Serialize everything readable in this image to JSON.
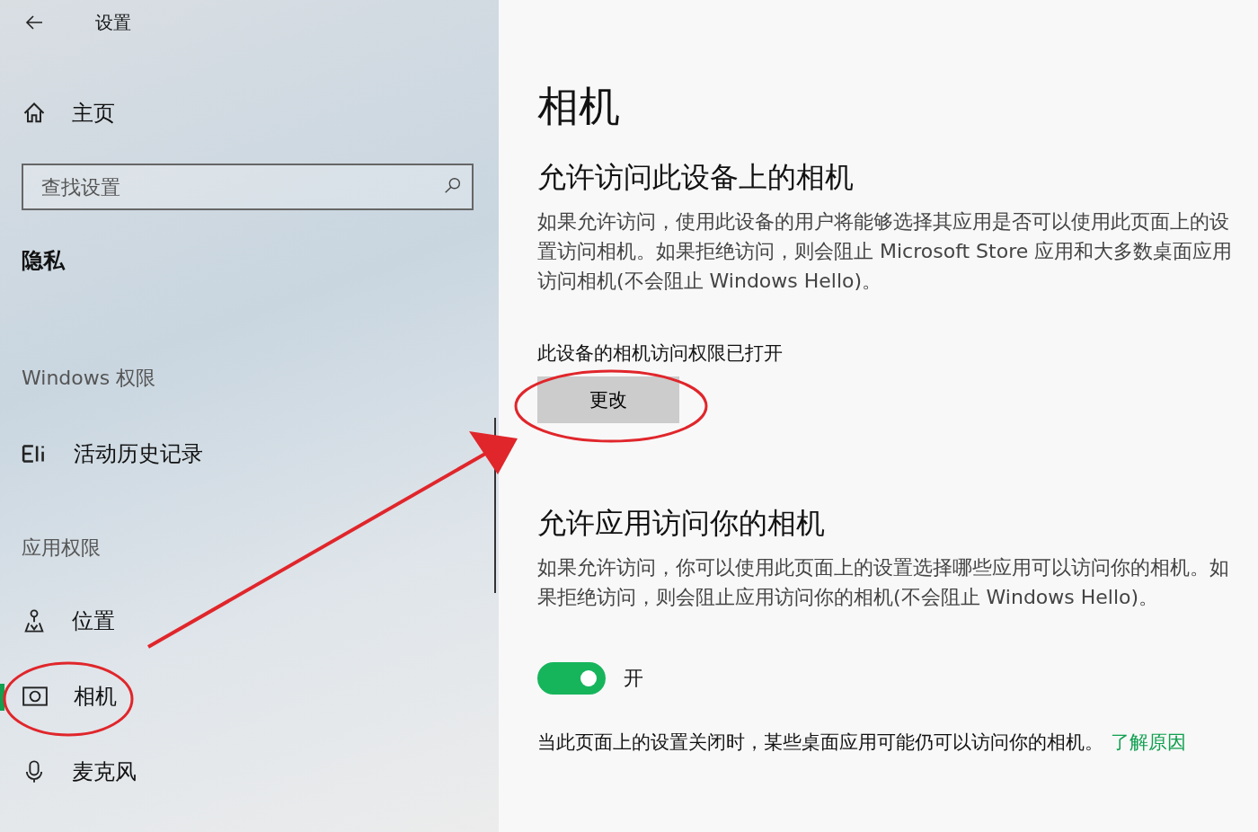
{
  "window": {
    "title": "设置"
  },
  "sidebar": {
    "home": "主页",
    "search": {
      "placeholder": "查找设置"
    },
    "section": "隐私",
    "groups": [
      {
        "heading": "Windows 权限",
        "items": [
          {
            "label": "活动历史记录",
            "kind": "history",
            "selected": false
          }
        ]
      },
      {
        "heading": "应用权限",
        "items": [
          {
            "label": "位置",
            "kind": "location",
            "selected": false
          },
          {
            "label": "相机",
            "kind": "camera",
            "selected": true
          },
          {
            "label": "麦克风",
            "kind": "mic",
            "selected": false
          }
        ]
      }
    ]
  },
  "content": {
    "title": "相机",
    "device_access": {
      "heading": "允许访问此设备上的相机",
      "description": "如果允许访问，使用此设备的用户将能够选择其应用是否可以使用此页面上的设置访问相机。如果拒绝访问，则会阻止 Microsoft Store 应用和大多数桌面应用访问相机(不会阻止 Windows Hello)。",
      "status": "此设备的相机访问权限已打开",
      "button": "更改"
    },
    "app_access": {
      "heading": "允许应用访问你的相机",
      "description": "如果允许访问，你可以使用此页面上的设置选择哪些应用可以访问你的相机。如果拒绝访问，则会阻止应用访问你的相机(不会阻止 Windows Hello)。",
      "toggle": {
        "on": true,
        "label": "开"
      }
    },
    "footer": {
      "text": "当此页面上的设置关闭时，某些桌面应用可能仍可以访问你的相机。",
      "link": "了解原因"
    }
  }
}
